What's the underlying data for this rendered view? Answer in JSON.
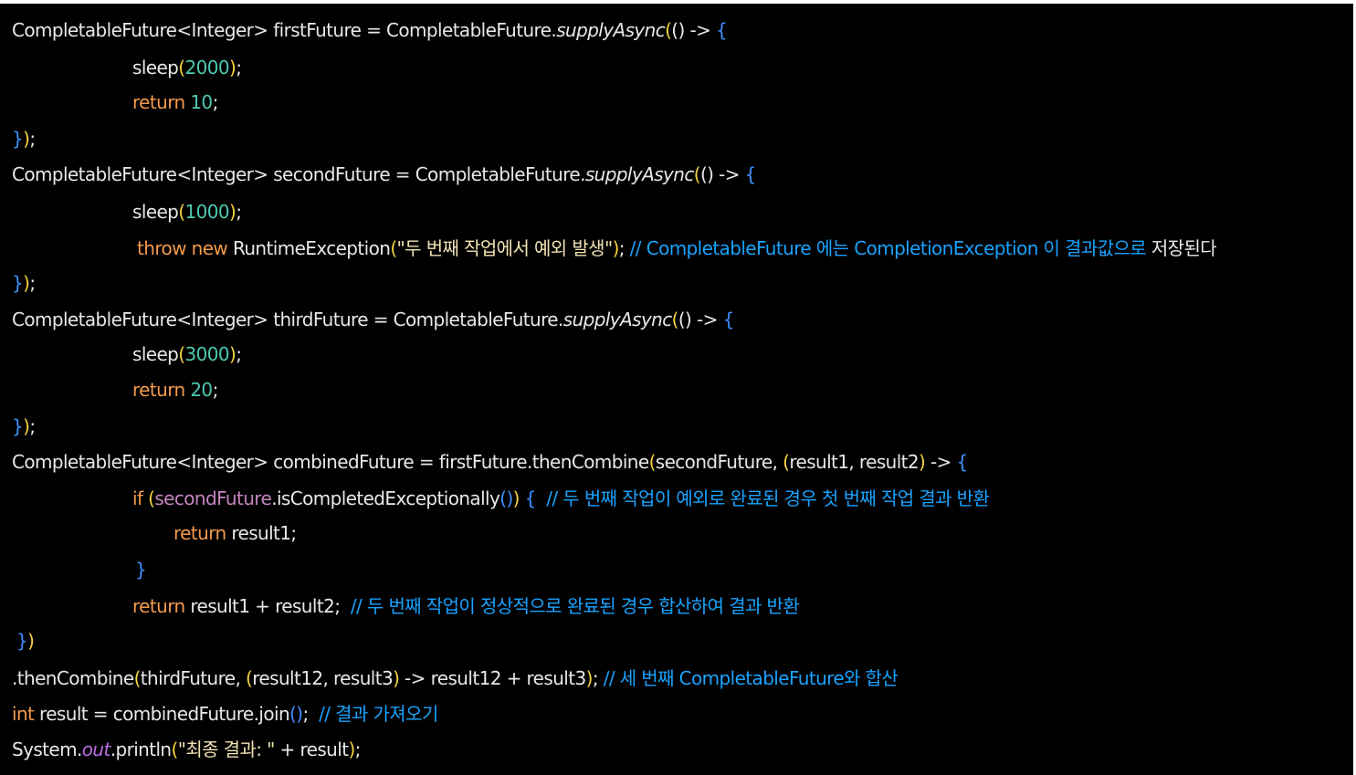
{
  "code": {
    "lines": [
      {
        "tokens": [
          {
            "t": "CompletableFuture<Integer> firstFuture = CompletableFuture.",
            "c": "default"
          },
          {
            "t": "supplyAsync",
            "c": "italic-method"
          },
          {
            "t": "(",
            "c": "paren"
          },
          {
            "t": "() -> ",
            "c": "default"
          },
          {
            "t": "{",
            "c": "brace"
          }
        ]
      },
      {
        "tokens": [
          {
            "t": "sleep",
            "c": "method"
          },
          {
            "t": "(",
            "c": "paren"
          },
          {
            "t": "2000",
            "c": "number"
          },
          {
            "t": ")",
            "c": "paren"
          },
          {
            "t": ";",
            "c": "default"
          }
        ]
      },
      {
        "tokens": [
          {
            "t": "return ",
            "c": "keyword"
          },
          {
            "t": "10",
            "c": "number"
          },
          {
            "t": ";",
            "c": "default"
          }
        ]
      },
      {
        "tokens": [
          {
            "t": "}",
            "c": "brace"
          },
          {
            "t": ")",
            "c": "paren"
          },
          {
            "t": ";",
            "c": "default"
          }
        ]
      },
      {
        "tokens": [
          {
            "t": "CompletableFuture<Integer> secondFuture = CompletableFuture.",
            "c": "default"
          },
          {
            "t": "supplyAsync",
            "c": "italic-method"
          },
          {
            "t": "(",
            "c": "paren"
          },
          {
            "t": "() -> ",
            "c": "default"
          },
          {
            "t": "{",
            "c": "brace"
          }
        ]
      },
      {
        "tokens": [
          {
            "t": "sleep",
            "c": "method"
          },
          {
            "t": "(",
            "c": "paren"
          },
          {
            "t": "1000",
            "c": "number"
          },
          {
            "t": ")",
            "c": "paren"
          },
          {
            "t": ";",
            "c": "default"
          }
        ]
      },
      {
        "tokens": [
          {
            "t": "throw new ",
            "c": "keyword"
          },
          {
            "t": "RuntimeException",
            "c": "default"
          },
          {
            "t": "(",
            "c": "paren"
          },
          {
            "t": "\"두 번째 작업에서 예외 발생\"",
            "c": "string"
          },
          {
            "t": ")",
            "c": "paren"
          },
          {
            "t": "; ",
            "c": "default"
          },
          {
            "t": "// CompletableFuture 에는 CompletionException 이 결과값으로 ",
            "c": "comment"
          },
          {
            "t": "저장된다",
            "c": "default"
          }
        ]
      },
      {
        "tokens": [
          {
            "t": "}",
            "c": "brace"
          },
          {
            "t": ")",
            "c": "paren"
          },
          {
            "t": ";",
            "c": "default"
          }
        ]
      },
      {
        "tokens": [
          {
            "t": "CompletableFuture<Integer> thirdFuture = CompletableFuture.",
            "c": "default"
          },
          {
            "t": "supplyAsync",
            "c": "italic-method"
          },
          {
            "t": "(",
            "c": "paren"
          },
          {
            "t": "() -> ",
            "c": "default"
          },
          {
            "t": "{",
            "c": "brace"
          }
        ]
      },
      {
        "tokens": [
          {
            "t": "sleep",
            "c": "method"
          },
          {
            "t": "(",
            "c": "paren"
          },
          {
            "t": "3000",
            "c": "number"
          },
          {
            "t": ")",
            "c": "paren"
          },
          {
            "t": ";",
            "c": "default"
          }
        ]
      },
      {
        "tokens": [
          {
            "t": "return ",
            "c": "keyword"
          },
          {
            "t": "20",
            "c": "number"
          },
          {
            "t": ";",
            "c": "default"
          }
        ]
      },
      {
        "tokens": [
          {
            "t": "}",
            "c": "brace"
          },
          {
            "t": ")",
            "c": "paren"
          },
          {
            "t": ";",
            "c": "default"
          }
        ]
      },
      {
        "tokens": [
          {
            "t": "CompletableFuture<Integer> combinedFuture = firstFuture.thenCombine",
            "c": "default"
          },
          {
            "t": "(",
            "c": "paren"
          },
          {
            "t": "secondFuture, ",
            "c": "default"
          },
          {
            "t": "(",
            "c": "paren"
          },
          {
            "t": "result1, result2",
            "c": "default"
          },
          {
            "t": ")",
            "c": "paren"
          },
          {
            "t": " -> ",
            "c": "default"
          },
          {
            "t": "{",
            "c": "brace"
          }
        ]
      },
      {
        "tokens": [
          {
            "t": "if ",
            "c": "keyword"
          },
          {
            "t": "(",
            "c": "paren"
          },
          {
            "t": "secondFuture",
            "c": "variable"
          },
          {
            "t": ".isCompletedExceptionally",
            "c": "default"
          },
          {
            "t": "()",
            "c": "brace"
          },
          {
            "t": ")",
            "c": "paren"
          },
          {
            "t": " ",
            "c": "default"
          },
          {
            "t": "{",
            "c": "brace"
          },
          {
            "t": "  // 두 번째 작업이 예외로 완료된 경우 첫 번째 작업 결과 반환",
            "c": "comment"
          }
        ]
      },
      {
        "tokens": [
          {
            "t": "return ",
            "c": "keyword"
          },
          {
            "t": "result1",
            "c": "default"
          },
          {
            "t": ";",
            "c": "default"
          }
        ]
      },
      {
        "tokens": [
          {
            "t": "}",
            "c": "brace"
          }
        ]
      },
      {
        "tokens": [
          {
            "t": "return ",
            "c": "keyword"
          },
          {
            "t": "result1 + result2",
            "c": "default"
          },
          {
            "t": ";  ",
            "c": "default"
          },
          {
            "t": "// 두 번째 작업이 정상적으로 완료된 경우 합산하여 결과 반환",
            "c": "comment"
          }
        ]
      },
      {
        "tokens": [
          {
            "t": "}",
            "c": "brace"
          },
          {
            "t": ")",
            "c": "paren"
          }
        ]
      },
      {
        "tokens": [
          {
            "t": ".thenCombine",
            "c": "default"
          },
          {
            "t": "(",
            "c": "paren"
          },
          {
            "t": "thirdFuture, ",
            "c": "default"
          },
          {
            "t": "(",
            "c": "paren"
          },
          {
            "t": "result12, result3",
            "c": "default"
          },
          {
            "t": ")",
            "c": "paren"
          },
          {
            "t": " -> result12 + result3",
            "c": "default"
          },
          {
            "t": ")",
            "c": "paren"
          },
          {
            "t": "; ",
            "c": "default"
          },
          {
            "t": "// 세 번째 CompletableFuture와 합산",
            "c": "comment"
          }
        ]
      },
      {
        "tokens": [
          {
            "t": "int ",
            "c": "keyword"
          },
          {
            "t": "result = combinedFuture.join",
            "c": "default"
          },
          {
            "t": "()",
            "c": "brace"
          },
          {
            "t": ";  ",
            "c": "default"
          },
          {
            "t": "// 결과 가져오기",
            "c": "comment"
          }
        ]
      },
      {
        "tokens": [
          {
            "t": "System.",
            "c": "default"
          },
          {
            "t": "out",
            "c": "static-field"
          },
          {
            "t": ".println",
            "c": "default"
          },
          {
            "t": "(",
            "c": "paren"
          },
          {
            "t": "\"최종 결과: \"",
            "c": "string"
          },
          {
            "t": " + result",
            "c": "default"
          },
          {
            "t": ")",
            "c": "paren"
          },
          {
            "t": ";",
            "c": "default"
          }
        ]
      }
    ]
  },
  "colors": {
    "background": "#000000",
    "default": "#e8e8e8",
    "keyword": "#f39a4e",
    "number": "#4ec9b0",
    "string": "#f1e3b4",
    "comment": "#1aa3ff",
    "paren": "#f6d33d",
    "brace": "#3e8fff",
    "variable": "#c586c0",
    "static-field": "#b96ee6"
  }
}
